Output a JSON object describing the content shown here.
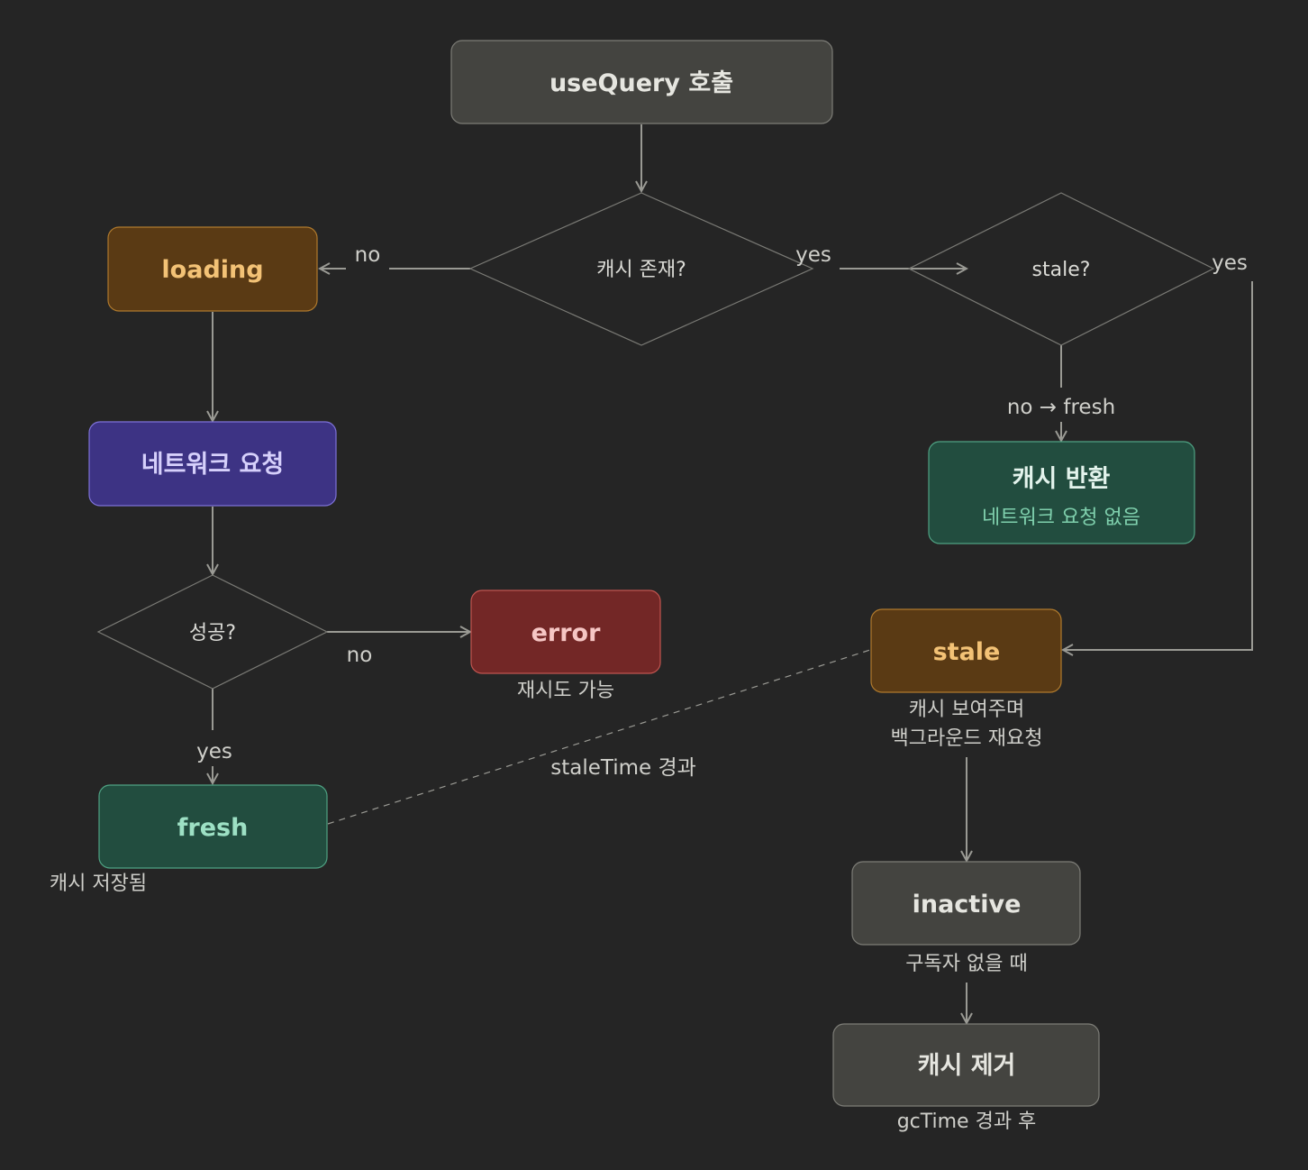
{
  "nodes": {
    "usequery": {
      "title": "useQuery 호출"
    },
    "cache_exists": {
      "label": "캐시 존재?"
    },
    "loading": {
      "title": "loading"
    },
    "network": {
      "title": "네트워크 요청"
    },
    "success": {
      "label": "성공?"
    },
    "error": {
      "title": "error",
      "note": "재시도 가능"
    },
    "fresh": {
      "title": "fresh",
      "note": "캐시 저장됨"
    },
    "is_stale": {
      "label": "stale?"
    },
    "cache_return": {
      "title": "캐시 반환",
      "subtitle": "네트워크 요청 없음"
    },
    "stale": {
      "title": "stale",
      "note_line1": "캐시 보여주며",
      "note_line2": "백그라운드 재요청"
    },
    "inactive": {
      "title": "inactive",
      "note": "구독자 없을 때"
    },
    "cache_remove": {
      "title": "캐시 제거",
      "note": "gcTime 경과 후"
    }
  },
  "edges": {
    "cache_no": "no",
    "cache_yes": "yes",
    "stale_yes": "yes",
    "stale_no_fresh": "no → fresh",
    "success_no": "no",
    "success_yes": "yes",
    "stale_time": "staleTime 경과"
  },
  "colors": {
    "background": "#252525",
    "neutral_fill": "#444440",
    "neutral_text": "#e6e6e0",
    "loading_fill": "#5a3a14",
    "loading_text": "#f3c276",
    "network_fill": "#3d3384",
    "network_text": "#d6d0fb",
    "error_fill": "#732726",
    "error_text": "#f6c6c4",
    "fresh_fill": "#224d3f",
    "fresh_text": "#9de0c4",
    "edge": "#9a9a94"
  }
}
